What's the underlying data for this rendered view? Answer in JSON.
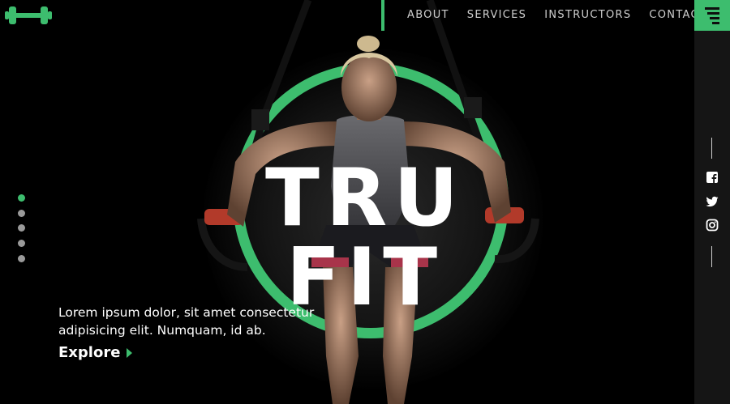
{
  "brand": {
    "accent": "#3dbd6e",
    "logo_icon": "dumbbell-icon"
  },
  "nav": {
    "items": [
      "ABOUT",
      "SERVICES",
      "INSTRUCTORS",
      "CONTACT"
    ]
  },
  "hero": {
    "title": "TRU FIT",
    "tagline": "Lorem ipsum dolor, sit amet consectetur adipisicing elit. Numquam, id ab.",
    "cta_label": "Explore"
  },
  "slider": {
    "count": 5,
    "active": 0
  },
  "social": [
    "facebook-icon",
    "twitter-icon",
    "instagram-icon"
  ],
  "menu_icon": "hamburger-menu-icon"
}
